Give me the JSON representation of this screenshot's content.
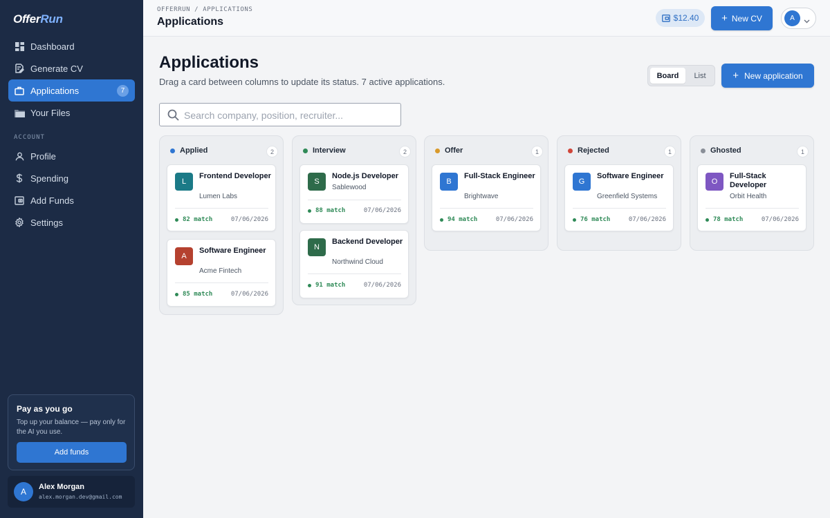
{
  "brand": {
    "part1": "Offer",
    "part2": "Run"
  },
  "sidebar": {
    "items": [
      {
        "label": "Dashboard",
        "icon": "dashboard-icon"
      },
      {
        "label": "Generate CV",
        "icon": "generate-cv-icon"
      },
      {
        "label": "Applications",
        "icon": "briefcase-icon",
        "badge": "7",
        "active": true
      },
      {
        "label": "Your Files",
        "icon": "folder-icon"
      }
    ],
    "account_label": "ACCOUNT",
    "account_items": [
      {
        "label": "Profile",
        "icon": "user-icon"
      },
      {
        "label": "Spending",
        "icon": "dollar-icon"
      },
      {
        "label": "Add Funds",
        "icon": "wallet-icon"
      },
      {
        "label": "Settings",
        "icon": "gear-icon"
      }
    ],
    "promo": {
      "title": "Pay as you go",
      "text": "Top up your balance — pay only for the AI you use.",
      "button": "Add funds"
    },
    "user": {
      "initial": "A",
      "name": "Alex Morgan",
      "email": "alex.morgan.dev@gmail.com"
    }
  },
  "topbar": {
    "breadcrumb": "OFFERRUN / APPLICATIONS",
    "title": "Applications",
    "balance": "$12.40",
    "new_cv": "New CV",
    "avatar_initial": "A"
  },
  "page": {
    "title": "Applications",
    "subtitle": "Drag a card between columns to update its status. 7 active applications.",
    "view_board": "Board",
    "view_list": "List",
    "new_application": "New application",
    "search_placeholder": "Search company, position, recruiter..."
  },
  "board": {
    "columns": [
      {
        "label": "Applied",
        "count": "2",
        "color": "#2f76d2",
        "cards": [
          {
            "initial": "L",
            "role": "Frontend Developer",
            "company": "Lumen Labs",
            "match": "82 match",
            "date": "07/06/2026",
            "color": "#1b7a87"
          },
          {
            "initial": "A",
            "role": "Software Engineer",
            "company": "Acme Fintech",
            "match": "85 match",
            "date": "07/06/2026",
            "color": "#b5412f"
          }
        ]
      },
      {
        "label": "Interview",
        "count": "2",
        "color": "#2f8a57",
        "cards": [
          {
            "initial": "S",
            "role": "Node.js Developer",
            "company": "Sablewood",
            "match": "88 match",
            "date": "07/06/2026",
            "color": "#2e6b4a"
          },
          {
            "initial": "N",
            "role": "Backend Developer",
            "company": "Northwind Cloud",
            "match": "91 match",
            "date": "07/06/2026",
            "color": "#2e6b4a"
          }
        ]
      },
      {
        "label": "Offer",
        "count": "1",
        "color": "#d99a2b",
        "cards": [
          {
            "initial": "B",
            "role": "Full-Stack Engineer",
            "company": "Brightwave",
            "match": "94 match",
            "date": "07/06/2026",
            "color": "#2f76d2"
          }
        ]
      },
      {
        "label": "Rejected",
        "count": "1",
        "color": "#d0463a",
        "cards": [
          {
            "initial": "G",
            "role": "Software Engineer",
            "company": "Greenfield Systems",
            "match": "76 match",
            "date": "07/06/2026",
            "color": "#2f76d2"
          }
        ]
      },
      {
        "label": "Ghosted",
        "count": "1",
        "color": "#8a8f98",
        "cards": [
          {
            "initial": "O",
            "role": "Full-Stack Developer",
            "company": "Orbit Health",
            "match": "78 match",
            "date": "07/06/2026",
            "color": "#7e57c2"
          }
        ]
      }
    ]
  }
}
